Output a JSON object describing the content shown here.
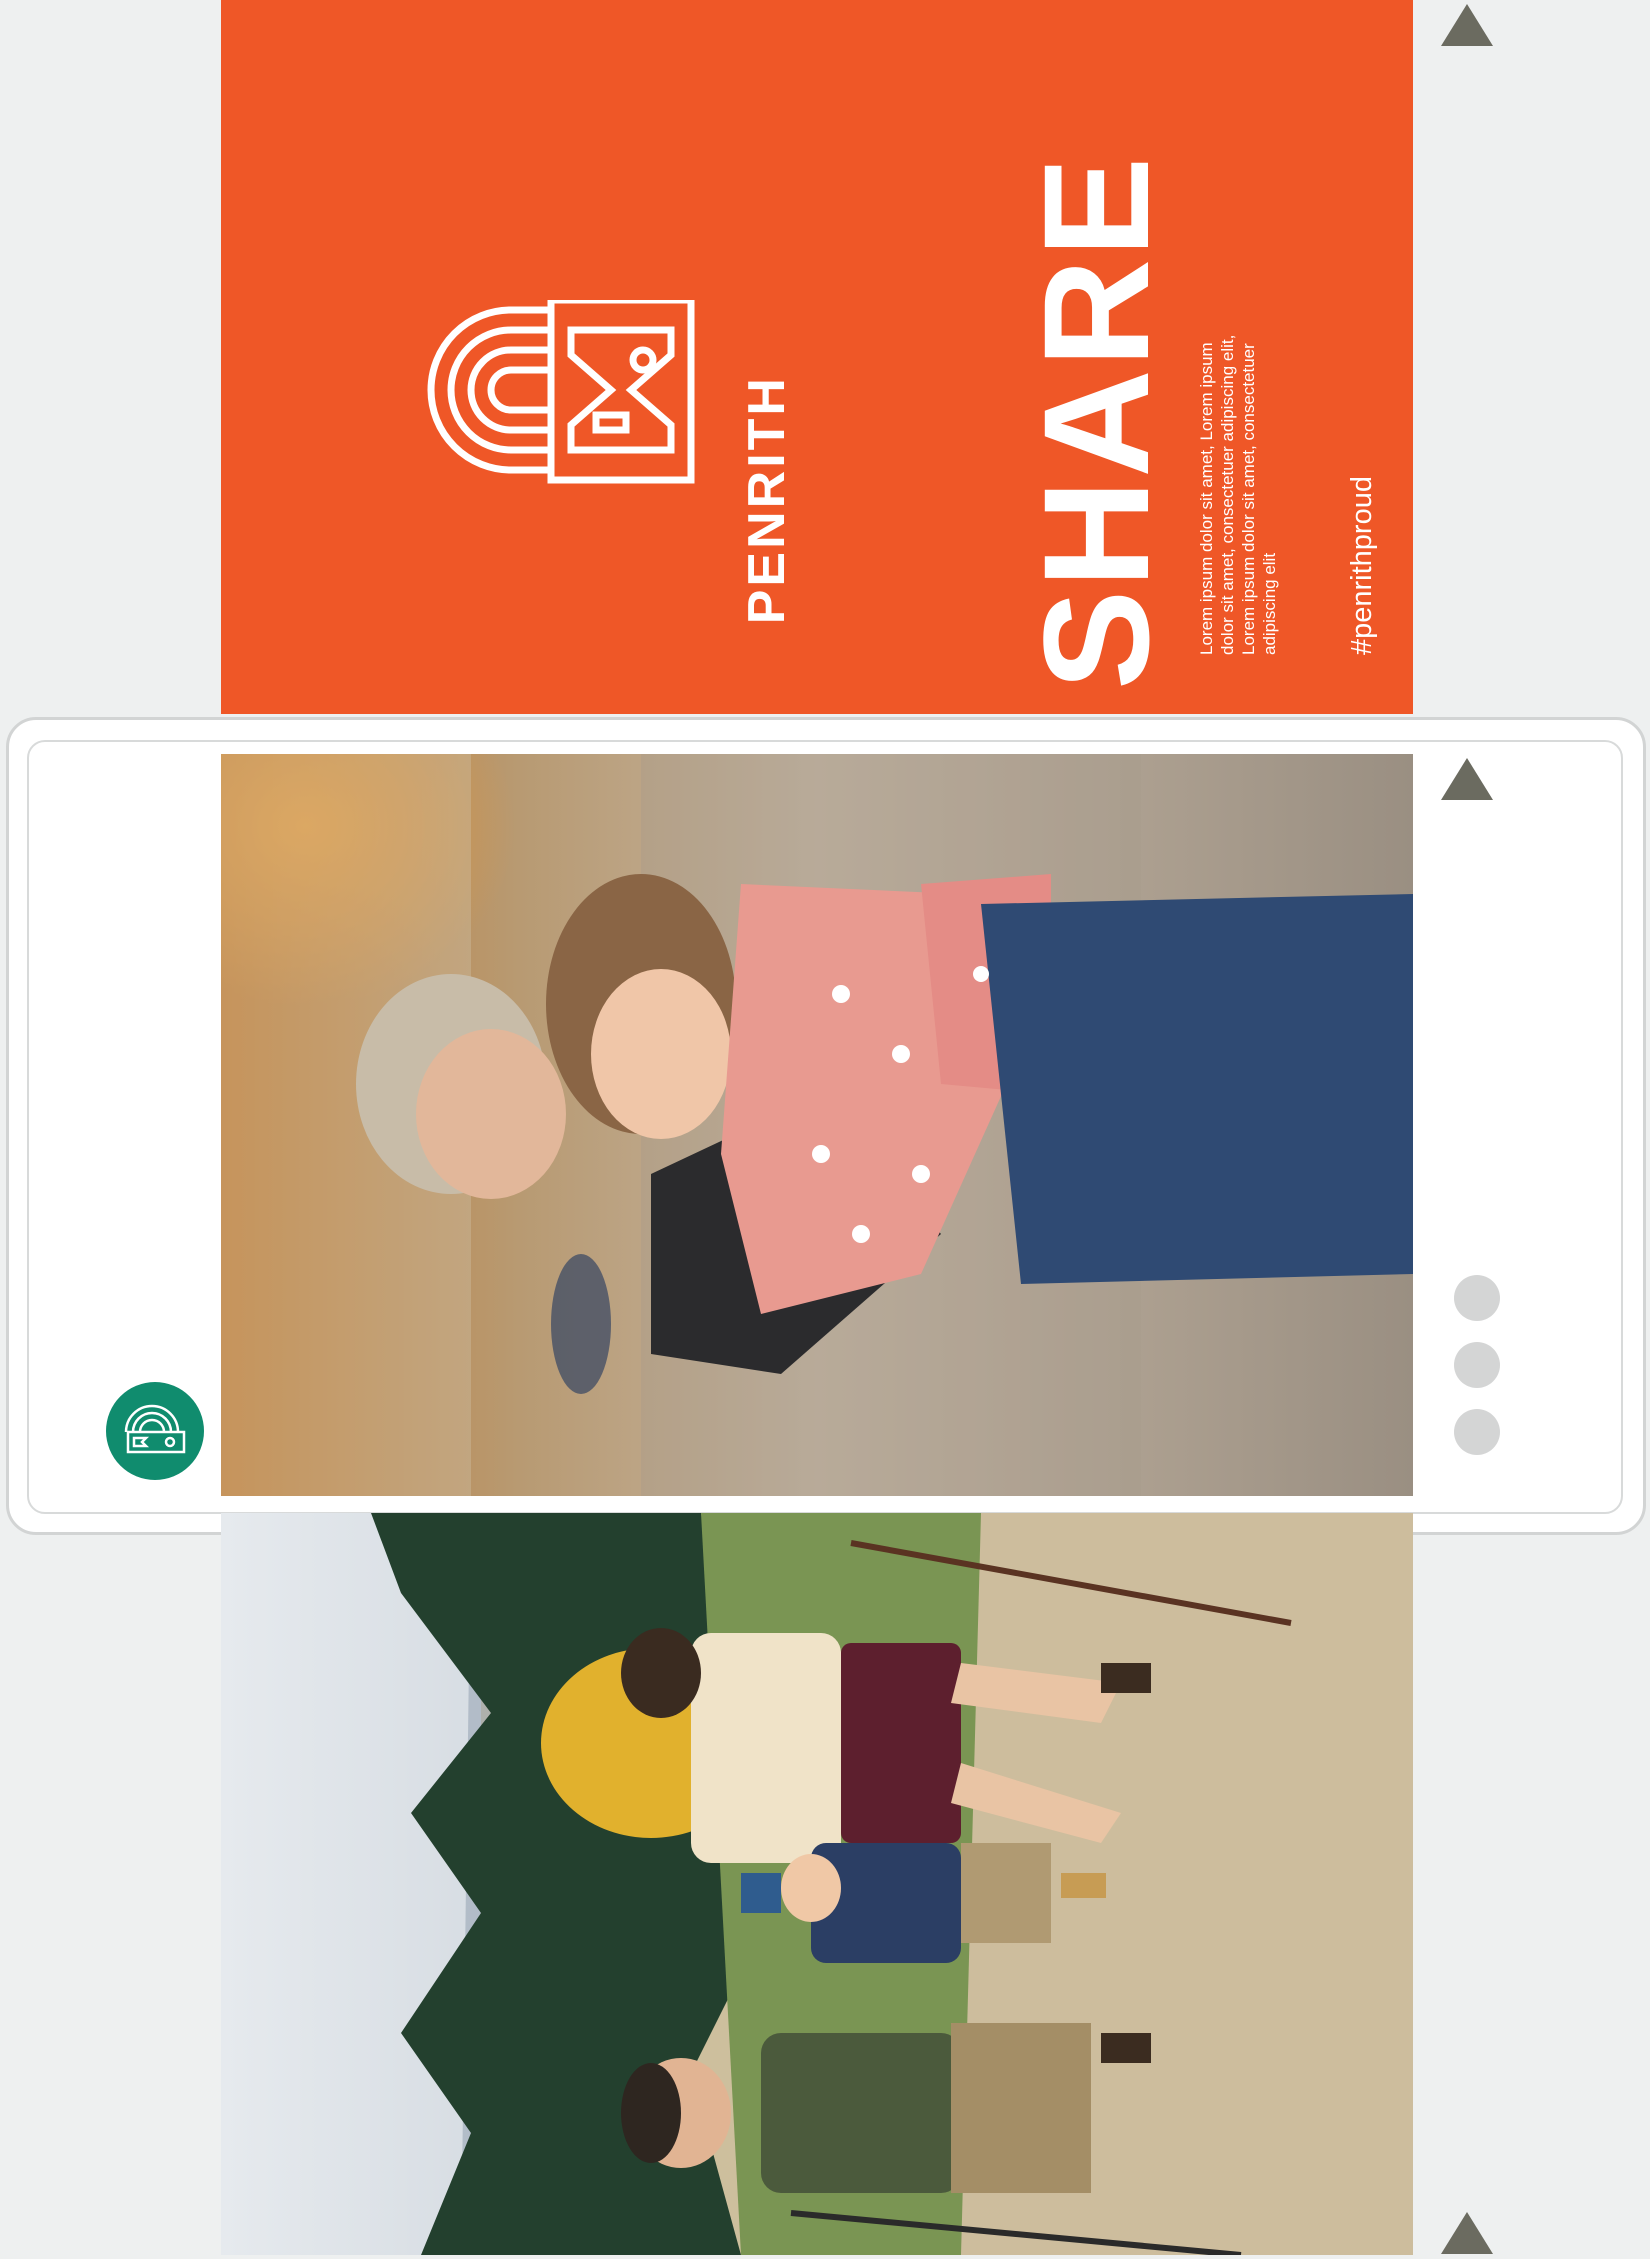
{
  "top_panel": {
    "title": "SHARE",
    "logo_text": "PENRITH",
    "body": "Lorem ipsum dolor sit amet, Lorem ipsum dolor sit amet, consectetuer adipiscing elit, Lorem ipsum dolor sit amet, consectetuer adipiscing elit",
    "hashtag": "#penrithproud",
    "background": "#ef5727"
  },
  "card": {
    "avatar_color": "#108c6e",
    "more_icon": "vertical-dots-icon",
    "photo": "kids-hugging-photo"
  },
  "bottom_photo": "family-hiking-photo",
  "nav": {
    "icon": "triangle-up-icon",
    "color": "#6b6b60"
  }
}
